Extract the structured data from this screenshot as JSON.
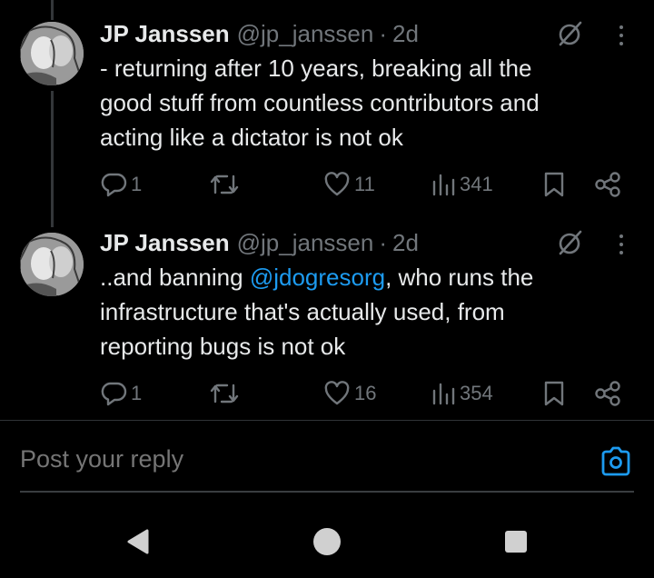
{
  "tweets": [
    {
      "name": "JP Janssen",
      "handle": "@jp_janssen",
      "dot": "·",
      "time": "2d",
      "text_lines": [
        "- returning after 10 years, breaking all the",
        "good stuff from countless contributors and",
        "acting like a dictator is not ok"
      ],
      "replies": "1",
      "likes": "11",
      "views": "341"
    },
    {
      "name": "JP Janssen",
      "handle": "@jp_janssen",
      "dot": "·",
      "time": "2d",
      "text_prefix": "..and banning ",
      "mention": "@jdogresorg",
      "text_suffix": ", who runs the",
      "text_lines": [
        "infrastructure that's actually used, from",
        "reporting bugs is not ok"
      ],
      "replies": "1",
      "likes": "16",
      "views": "354"
    }
  ],
  "reply_bar": {
    "placeholder": "Post your reply"
  },
  "colors": {
    "background": "#000000",
    "text": "#e7e9ea",
    "muted": "#71767b",
    "accent": "#1d9bf0"
  },
  "icons": {
    "reply": "speech-bubble",
    "retweet": "repost-arrows",
    "like": "heart",
    "views": "bar-chart",
    "bookmark": "bookmark",
    "share": "share-nodes",
    "grok": "slashed-circle",
    "more": "vertical-ellipsis",
    "camera": "camera",
    "nav_back": "triangle-left",
    "nav_home": "circle",
    "nav_recents": "square"
  }
}
